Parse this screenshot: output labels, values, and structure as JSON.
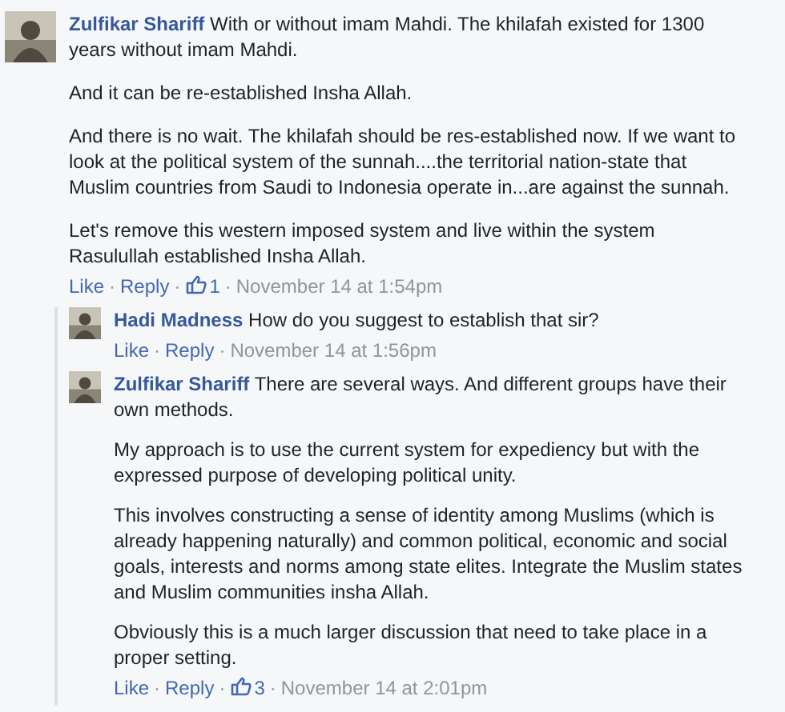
{
  "comments": [
    {
      "author": "Zulfikar Shariff",
      "paragraphs": [
        "With or without imam Mahdi. The khilafah existed for 1300 years without imam Mahdi.",
        "And it can be re-established Insha Allah.",
        "And there is no wait. The khilafah should be res-established now. If we want to look at the political system of the sunnah....the territorial nation-state that Muslim countries from Saudi to Indonesia operate in...are against the sunnah.",
        "Let's remove this western imposed system and live within the system Rasulullah established Insha Allah."
      ],
      "footer": [
        {
          "kind": "link",
          "text": "Like"
        },
        {
          "kind": "sep",
          "text": "·"
        },
        {
          "kind": "link",
          "text": "Reply"
        },
        {
          "kind": "sep",
          "text": "·"
        },
        {
          "kind": "likes",
          "text": "1"
        },
        {
          "kind": "sep",
          "text": "·"
        },
        {
          "kind": "time",
          "text": "November 14 at 1:54pm"
        }
      ],
      "replies": [
        {
          "author": "Hadi Madness",
          "paragraphs": [
            "How do you suggest to establish that sir?"
          ],
          "footer": [
            {
              "kind": "link",
              "text": "Like"
            },
            {
              "kind": "sep",
              "text": "·"
            },
            {
              "kind": "link",
              "text": "Reply"
            },
            {
              "kind": "sep",
              "text": "·"
            },
            {
              "kind": "time",
              "text": "November 14 at 1:56pm"
            }
          ]
        },
        {
          "author": "Zulfikar Shariff",
          "paragraphs": [
            "There are several ways. And different groups have their own methods.",
            "My approach is to use the current system for expediency but with the expressed purpose of developing political unity.",
            "This involves constructing a sense of identity among Muslims (which is already happening naturally) and common political, economic and social goals, interests and norms among state elites. Integrate the Muslim states and Muslim communities insha Allah.",
            "Obviously this is a much larger discussion that need to take place in a proper setting."
          ],
          "footer": [
            {
              "kind": "link",
              "text": "Like"
            },
            {
              "kind": "sep",
              "text": "·"
            },
            {
              "kind": "link",
              "text": "Reply"
            },
            {
              "kind": "sep",
              "text": "·"
            },
            {
              "kind": "likes",
              "text": "3"
            },
            {
              "kind": "sep",
              "text": "·"
            },
            {
              "kind": "time",
              "text": "November 14 at 2:01pm"
            }
          ]
        }
      ]
    }
  ]
}
